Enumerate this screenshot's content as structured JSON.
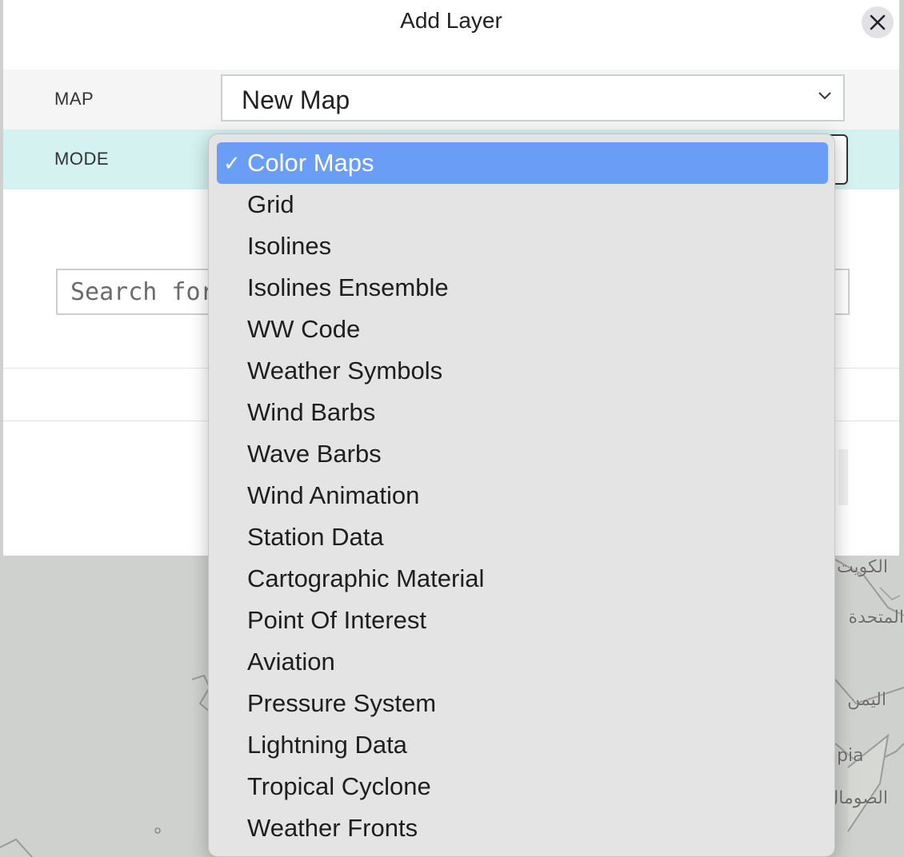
{
  "map_labels": [
    "الكويت",
    "المتحدة",
    "اليمن",
    "pia",
    "الصومال"
  ],
  "dialog": {
    "title": "Add Layer",
    "close_icon": "close-icon"
  },
  "map_row": {
    "label": "MAP",
    "value": "New Map"
  },
  "mode_row": {
    "label": "MODE"
  },
  "search": {
    "placeholder": "Search for ..."
  },
  "dropdown": {
    "selected": "Color Maps",
    "options": [
      "Color Maps",
      "Grid",
      "Isolines",
      "Isolines Ensemble",
      "WW Code",
      "Weather Symbols",
      "Wind Barbs",
      "Wave Barbs",
      "Wind Animation",
      "Station Data",
      "Cartographic Material",
      "Point Of Interest",
      "Aviation",
      "Pressure System",
      "Lightning Data",
      "Tropical Cyclone",
      "Weather Fronts"
    ]
  },
  "colors": {
    "selected_bg": "#6a9ef6",
    "mode_row_bg": "#d4f2f0"
  }
}
